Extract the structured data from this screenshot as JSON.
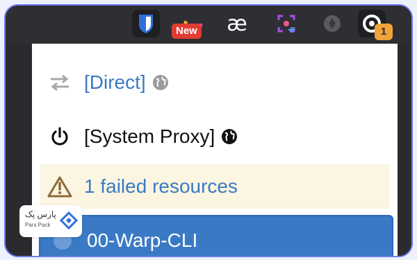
{
  "toolbar": {
    "new_badge": "New",
    "extension_count": "1",
    "ae_label": "æ"
  },
  "menu": {
    "direct_label": "[Direct]",
    "system_proxy_label": "[System Proxy]",
    "failed_label": "1 failed resources",
    "profile_label": "00-Warp-CLI"
  },
  "watermark": {
    "brand_fa": "پارس پک",
    "brand_en": "Pars Pack"
  },
  "colors": {
    "accent_blue": "#3a7ac4",
    "warning_bg": "#fbf5e1",
    "badge_red": "#e23b34",
    "badge_orange": "#f0a33a"
  }
}
